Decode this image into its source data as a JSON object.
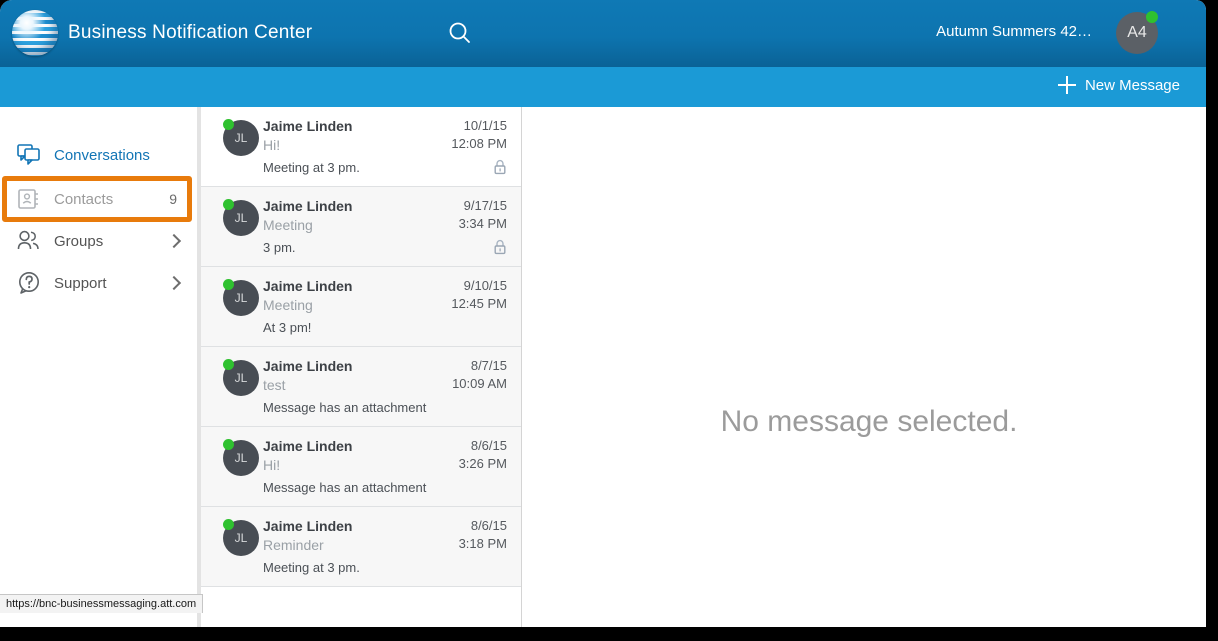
{
  "header": {
    "logo_icon": "att-globe-logo",
    "title": "Business Notification Center",
    "search_icon": "search-icon",
    "user_name": "Autumn Summers 42…",
    "avatar_initials": "A4",
    "avatar_status": "online"
  },
  "subheader": {
    "new_message_label": "New Message",
    "plus_icon": "plus-icon"
  },
  "sidebar": {
    "items": [
      {
        "label": "Conversations",
        "icon": "conversations-icon",
        "state": "active",
        "count": "",
        "chevron": false
      },
      {
        "label": "Contacts",
        "icon": "contacts-book-icon",
        "state": "inactive",
        "count": "9",
        "chevron": false
      },
      {
        "label": "Groups",
        "icon": "groups-people-icon",
        "state": "normal",
        "count": "",
        "chevron": true
      },
      {
        "label": "Support",
        "icon": "support-question-icon",
        "state": "normal",
        "count": "",
        "chevron": true
      }
    ],
    "highlight_target": "Contacts",
    "highlight_color": "#e87b0c"
  },
  "message_list": {
    "scrollbar": {
      "up_arrow_icon": "scroll-up-arrow-icon",
      "down_arrow_icon": "scroll-down-arrow-icon"
    },
    "items": [
      {
        "avatar_initials": "JL",
        "name": "Jaime Linden",
        "subject": "Hi!",
        "preview": "Meeting at 3 pm.",
        "date": "10/1/15",
        "time": "12:08 PM",
        "lock": true,
        "status": "online",
        "selected": true
      },
      {
        "avatar_initials": "JL",
        "name": "Jaime Linden",
        "subject": "Meeting",
        "preview": "3 pm.",
        "date": "9/17/15",
        "time": "3:34 PM",
        "lock": true,
        "status": "online",
        "selected": false
      },
      {
        "avatar_initials": "JL",
        "name": "Jaime Linden",
        "subject": "Meeting",
        "preview": "At 3 pm!",
        "date": "9/10/15",
        "time": "12:45 PM",
        "lock": false,
        "status": "online",
        "selected": false
      },
      {
        "avatar_initials": "JL",
        "name": "Jaime Linden",
        "subject": "test",
        "preview": "Message has an attachment",
        "date": "8/7/15",
        "time": "10:09 AM",
        "lock": false,
        "status": "online",
        "selected": false
      },
      {
        "avatar_initials": "JL",
        "name": "Jaime Linden",
        "subject": "Hi!",
        "preview": "Message has an attachment",
        "date": "8/6/15",
        "time": "3:26 PM",
        "lock": false,
        "status": "online",
        "selected": false
      },
      {
        "avatar_initials": "JL",
        "name": "Jaime Linden",
        "subject": "Reminder",
        "preview": "Meeting at 3 pm.",
        "date": "8/6/15",
        "time": "3:18 PM",
        "lock": false,
        "status": "online",
        "selected": false
      }
    ]
  },
  "main_panel": {
    "empty_message": "No message selected."
  },
  "status_bar": {
    "url": "https://bnc-businessmessaging.att.com"
  },
  "colors": {
    "header_blue": "#0d74af",
    "subheader_blue": "#1b9ad6",
    "accent_orange": "#e87b0c",
    "active_link_blue": "#1275b5",
    "online_green": "#2fc12f"
  }
}
